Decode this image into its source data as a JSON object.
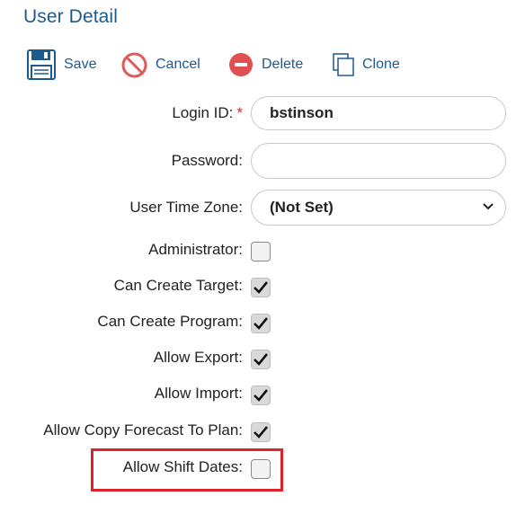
{
  "title": "User Detail",
  "toolbar": {
    "save": "Save",
    "cancel": "Cancel",
    "delete": "Delete",
    "clone": "Clone"
  },
  "form": {
    "login_id": {
      "label": "Login ID:",
      "required_mark": "*",
      "value": "bstinson"
    },
    "password": {
      "label": "Password:",
      "value": ""
    },
    "time_zone": {
      "label": "User Time Zone:",
      "value": "(Not Set)"
    },
    "checkboxes": [
      {
        "label": "Administrator:",
        "checked": false
      },
      {
        "label": "Can Create Target:",
        "checked": true
      },
      {
        "label": "Can Create Program:",
        "checked": true
      },
      {
        "label": "Allow Export:",
        "checked": true
      },
      {
        "label": "Allow Import:",
        "checked": true
      },
      {
        "label": "Allow Copy Forecast To Plan:",
        "checked": true
      },
      {
        "label": "Allow Shift Dates:",
        "checked": false
      }
    ]
  },
  "colors": {
    "title": "#1f5a8f",
    "accent_red": "#d9261c",
    "highlight_border": "#e0202a"
  },
  "icons": {
    "save": "floppy-disk-icon",
    "cancel": "prohibited-icon",
    "delete": "minus-circle-icon",
    "clone": "clone-icon",
    "select": "chevron-down-icon",
    "check": "checkmark-icon"
  }
}
